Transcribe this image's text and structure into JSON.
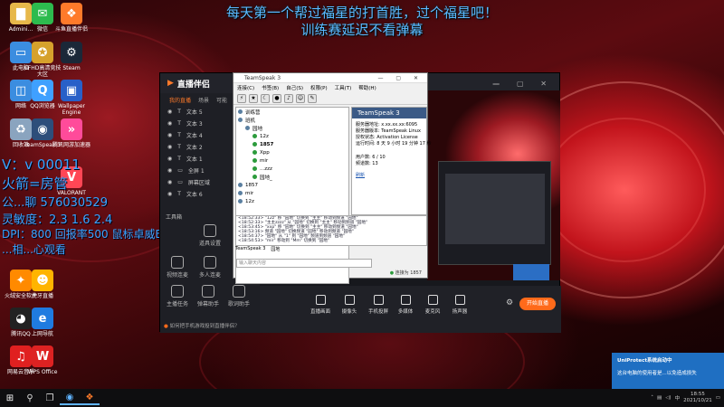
{
  "banner": {
    "line1": "每天第一个帮过福星的打首胜，过个福星吧！",
    "line2": "训练赛延迟不看弹幕"
  },
  "overlay": {
    "line1": "V：v 00011",
    "line2": "火箭=房管",
    "line3": "公...聊 576030529",
    "line4": "灵敏度：2.3 1.6 2.4",
    "line5": "DPI：800  回报率500  鼠标卓威EK1-B",
    "line6": "...相...心观看"
  },
  "desktop_icons": [
    {
      "label": "Admini...",
      "icon": "user-folder-icon",
      "color": "#e7b84a"
    },
    {
      "label": "微信",
      "icon": "wechat-icon",
      "color": "#2dbb4e"
    },
    {
      "label": "斗鱼直播伴侣",
      "icon": "douyu-icon",
      "color": "#ff7a2a"
    },
    {
      "label": "此电脑",
      "icon": "computer-icon",
      "color": "#3b8de0"
    },
    {
      "label": "CFHD高清竞技大区",
      "icon": "cfhd-icon",
      "color": "#d6a12c"
    },
    {
      "label": "Steam",
      "icon": "steam-icon",
      "color": "#1b2838"
    },
    {
      "label": "网络",
      "icon": "network-icon",
      "color": "#3b8de0"
    },
    {
      "label": "QQ浏览器",
      "icon": "qq-browser-icon",
      "color": "#3fa0ff"
    },
    {
      "label": "Wallpaper Engine",
      "icon": "wallpaper-engine-icon",
      "color": "#2860c8"
    },
    {
      "label": "回收站",
      "icon": "recycle-bin-icon",
      "color": "#8aa4bf"
    },
    {
      "label": "TeamSpeak 3",
      "icon": "teamspeak-icon",
      "color": "#2d4e7a"
    },
    {
      "label": "腾讯网游加速器",
      "icon": "tencent-accelerator-icon",
      "color": "#ff4b9a"
    },
    {
      "label": "VALORANT",
      "icon": "valorant-icon",
      "color": "#ff4655"
    },
    {
      "label": "火绒安全软件",
      "icon": "huorong-icon",
      "color": "#ff8a00"
    },
    {
      "label": "虎牙直播",
      "icon": "huya-icon",
      "color": "#ffb400"
    },
    {
      "label": "腾讯QQ",
      "icon": "qq-icon",
      "color": "#111"
    },
    {
      "label": "上网导航",
      "icon": "ie-icon",
      "color": "#1f7be0"
    },
    {
      "label": "网易云音乐",
      "icon": "netease-music-icon",
      "color": "#e02020"
    },
    {
      "label": "WPS Office",
      "icon": "wps-icon",
      "color": "#d22"
    }
  ],
  "stream_app": {
    "title": "直播伴侣",
    "tabs": [
      "我的直播",
      "场景",
      "可能",
      "..."
    ],
    "sources": [
      "文本 5",
      "文本 3",
      "文本 4",
      "文本 2",
      "文本 1",
      "全屏 1",
      "屏幕区域",
      "文本 6"
    ],
    "side_buttons": [
      "工具箱",
      "道具设置",
      "视频连麦",
      "多人连麦",
      "主播任务",
      "弹幕助手",
      "歌词助手"
    ],
    "bottom_buttons": [
      "直播画面",
      "摄像头",
      "手机投屏",
      "多媒体",
      "麦克风",
      "扬声器"
    ],
    "live_label": "开始直播",
    "notice": "如何把手机游戏投到直播伴侣？"
  },
  "teamspeak": {
    "window_title": "TeamSpeak 3",
    "menu": [
      "连接(C)",
      "书签(B)",
      "自己(S)",
      "权限(P)",
      "工具(T)",
      "帮助(H)"
    ],
    "tree": [
      {
        "name": "训练营",
        "level": 0
      },
      {
        "name": "班机",
        "level": 0
      },
      {
        "name": "园地",
        "level": 1
      },
      {
        "name": "12z",
        "level": 2
      },
      {
        "name": "1857",
        "level": 2
      },
      {
        "name": "Xpp",
        "level": 2
      },
      {
        "name": "mir",
        "level": 2
      },
      {
        "name": "...zzz",
        "level": 2
      },
      {
        "name": "园地_",
        "level": 2
      },
      {
        "name": "1857",
        "level": 0
      },
      {
        "name": "mir",
        "level": 0
      },
      {
        "name": "12z",
        "level": 0
      }
    ],
    "info": {
      "heading": "TeamSpeak 3",
      "rows": [
        "服务器地址: x.xx.xx.xx:6095",
        "服务器版本: TeamSpeak Linux",
        "授权状态: Activation License",
        "运行时间: 8 天 9 小时 19 分钟 17 秒",
        "用户数: 6 / 10",
        "频道数: 13"
      ],
      "link": "刷新"
    },
    "log": [
      "<18:52:33> \"12z\" 移 \"园地\" 切换到 \"主主\" 移动到频道 \"园地\"",
      "<18:52:33> \"主主zzzz\" 从 \"园地\" 切换到 \"主主\" 移动到频道 \"园地\"",
      "<18:53:45> \"xxp\" 移 \"园地\" 切换到 \"主主\" 移动到频道 \"园地\"",
      "<18:53:16> 频道 \"园地\" 切换频道 \"园地\" 移动到频道 \"园地\"",
      "<18:54:37> \"园地\" 从 \"1\" 到 \"园地\" 频道到频道 \"园地\"",
      "<18:54:53> \"mir\" 移动到 \"Mm\" 切换到 \"园地\""
    ],
    "bottom_tabs": [
      "TeamSpeak 3",
      "园地"
    ],
    "chat_placeholder": "输入聊天内容",
    "status": "连接为 1857"
  },
  "toast": {
    "title": "UniProtect系统启动中",
    "body": "这台电脑的使用者是...以免造成损失"
  },
  "tray": {
    "time": "18:55",
    "date": "2021/10/21",
    "lang": "中"
  },
  "colors": {
    "accent": "#ff6a1a",
    "overlay_text": "#3aa3ff",
    "ts_header": "#3b5a86"
  }
}
